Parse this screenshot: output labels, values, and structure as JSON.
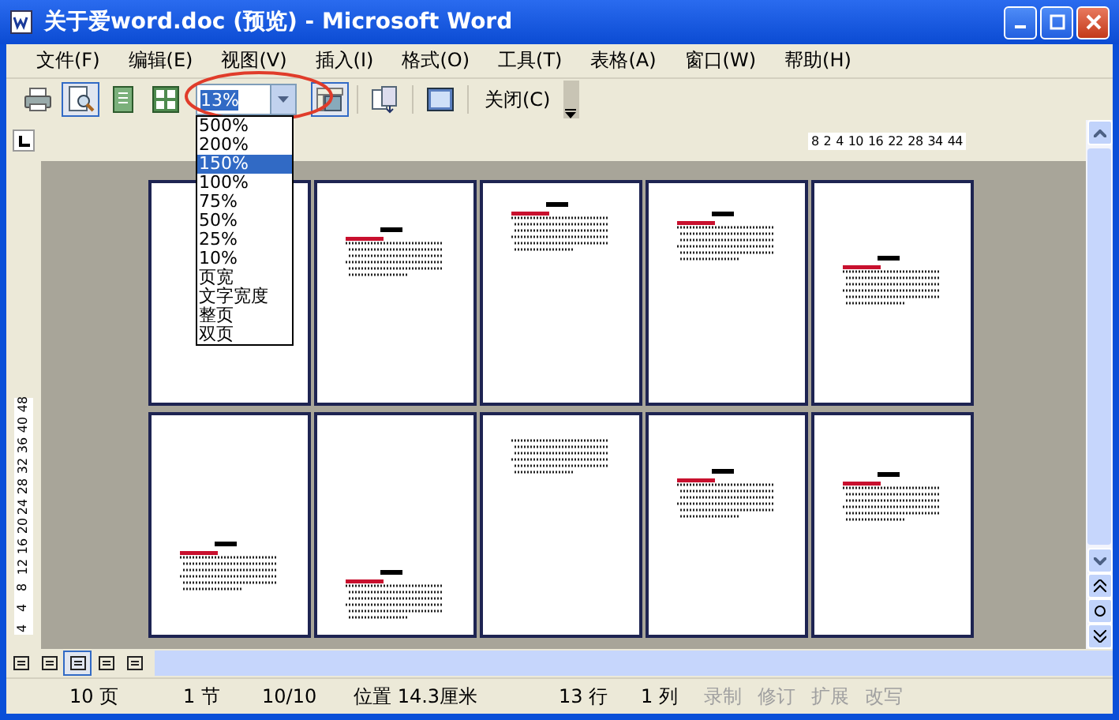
{
  "window": {
    "title": "关于爱word.doc (预览) - Microsoft Word"
  },
  "menu": [
    {
      "label": "文件(F)"
    },
    {
      "label": "编辑(E)"
    },
    {
      "label": "视图(V)"
    },
    {
      "label": "插入(I)"
    },
    {
      "label": "格式(O)"
    },
    {
      "label": "工具(T)"
    },
    {
      "label": "表格(A)"
    },
    {
      "label": "窗口(W)"
    },
    {
      "label": "帮助(H)"
    }
  ],
  "toolbar": {
    "left": [
      {
        "kind": "print",
        "pressed": false
      },
      {
        "kind": "magnifier",
        "pressed": true
      },
      {
        "kind": "one-page",
        "pressed": false
      },
      {
        "kind": "multi-page",
        "pressed": false
      }
    ],
    "zoom": {
      "value": "13%",
      "options": [
        {
          "label": "500%",
          "selected": false
        },
        {
          "label": "200%",
          "selected": false
        },
        {
          "label": "150%",
          "selected": true
        },
        {
          "label": "100%",
          "selected": false
        },
        {
          "label": "75%",
          "selected": false
        },
        {
          "label": "50%",
          "selected": false
        },
        {
          "label": "25%",
          "selected": false
        },
        {
          "label": "10%",
          "selected": false
        },
        {
          "label": "页宽",
          "selected": false
        },
        {
          "label": "文字宽度",
          "selected": false
        },
        {
          "label": "整页",
          "selected": false
        },
        {
          "label": "双页",
          "selected": false
        }
      ]
    },
    "right": [
      {
        "kind": "ruler",
        "pressed": true
      },
      {
        "kind": "shrink",
        "pressed": false
      },
      {
        "kind": "full-screen",
        "pressed": false
      }
    ],
    "close_button": "关闭(C)"
  },
  "ruler": {
    "horizontal": [
      "8",
      "2",
      "4",
      "10",
      "16",
      "22",
      "28",
      "34",
      "44"
    ],
    "vertical": [
      "4",
      "4",
      "8",
      "12",
      "16",
      "20",
      "24",
      "28",
      "32",
      "36",
      "40",
      "48"
    ]
  },
  "views": [
    {
      "selected": false
    },
    {
      "selected": false
    },
    {
      "selected": true
    },
    {
      "selected": false
    },
    {
      "selected": false
    }
  ],
  "status_bar": [
    {
      "text": "10 页",
      "disabled": false
    },
    {
      "text": "1 节",
      "disabled": false
    },
    {
      "text": "10/10",
      "disabled": false
    },
    {
      "text": "位置 14.3厘米",
      "disabled": false
    },
    {
      "text": "13 行",
      "disabled": false
    },
    {
      "text": "1 列",
      "disabled": false
    },
    {
      "text": "录制",
      "disabled": true
    },
    {
      "text": "修订",
      "disabled": true
    },
    {
      "text": "扩展",
      "disabled": true
    },
    {
      "text": "改写",
      "disabled": true
    }
  ]
}
